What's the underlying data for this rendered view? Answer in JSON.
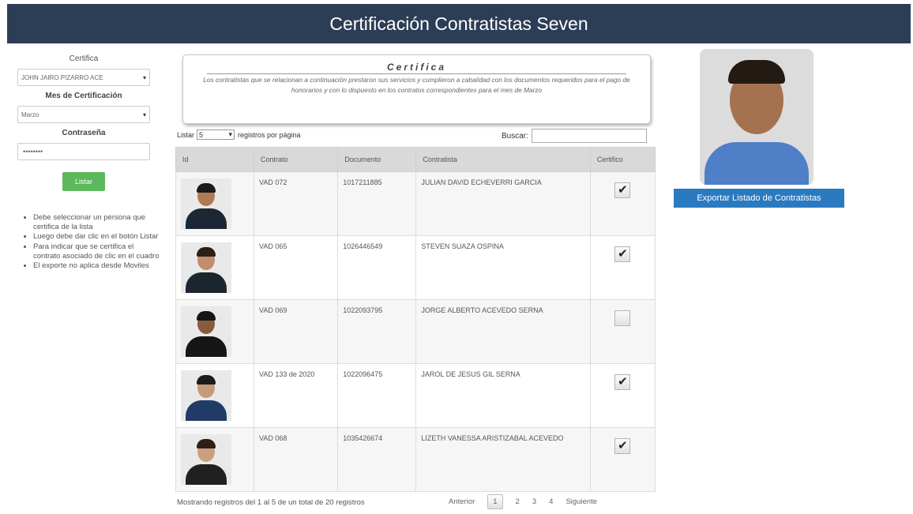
{
  "header": {
    "title": "Certificación Contratistas Seven"
  },
  "left": {
    "certifica_label": "Certifica",
    "certifica_value": "JOHN JAIRO PIZARRO ACE",
    "mes_label": "Mes de Certificación",
    "mes_value": "Marzo",
    "password_label": "Contraseña",
    "password_value": "••••••••",
    "listar_button": "Listar",
    "notes": [
      "Debe seleccionar un persona que certifica de la lista",
      "Luego debe dar clic en el botón Listar",
      "Para indicar que se certifica el contrato asociado de clic en el cuadro",
      "El exporte no aplica desde Moviles"
    ]
  },
  "cert": {
    "title": "Certifica",
    "text": "Los contratistas que se relacionan a continuación prestaron sus servicios y cumplieron a cabalidad con los documentos requeridos para el pago de honorarios y con lo dispuesto en los contratos correspondientes para el mes de Marzo"
  },
  "controls": {
    "listar_prefix": "Listar",
    "page_size": "5",
    "listar_suffix": "registros por página",
    "search_label": "Buscar:"
  },
  "table": {
    "headers": [
      "Id",
      "Contrato",
      "Documento",
      "Contratista",
      "Certifico"
    ],
    "rows": [
      {
        "contrato": "VAD 072",
        "documento": "1017211885",
        "contratista": "JULIAN DAVID ECHEVERRI GARCIA",
        "checked": true,
        "skin": "#b07a55",
        "hair": "#1e1a18",
        "shirt": "#1b2735"
      },
      {
        "contrato": "VAD 065",
        "documento": "1026446549",
        "contratista": "STEVEN SUAZA OSPINA",
        "checked": true,
        "skin": "#c08e6a",
        "hair": "#2a2018",
        "shirt": "#1c2630"
      },
      {
        "contrato": "VAD 069",
        "documento": "1022093795",
        "contratista": "JORGE ALBERTO ACEVEDO SERNA",
        "checked": false,
        "skin": "#8a5a3e",
        "hair": "#151515",
        "shirt": "#151515"
      },
      {
        "contrato": "VAD 133 de 2020",
        "documento": "1022096475",
        "contratista": "JAROL DE JESUS GIL SERNA",
        "checked": true,
        "skin": "#c49a78",
        "hair": "#1c1a1a",
        "shirt": "#1f3b66"
      },
      {
        "contrato": "VAD 068",
        "documento": "1035426674",
        "contratista": "LIZETH VANESSA ARISTIZABAL ACEVEDO",
        "checked": true,
        "skin": "#caa07e",
        "hair": "#2b1f18",
        "shirt": "#202020"
      }
    ]
  },
  "footer": {
    "info": "Mostrando registros del 1 al 5 de un total de 20 registros",
    "prev": "Anterior",
    "pages": [
      "1",
      "2",
      "3",
      "4"
    ],
    "next": "Siguiente"
  },
  "right": {
    "export_button": "Exportar Listado de Contratistas"
  },
  "colors": {
    "header_bg": "#2c3e56",
    "listar_button": "#5cb85c",
    "export_button": "#2a7ac0"
  }
}
